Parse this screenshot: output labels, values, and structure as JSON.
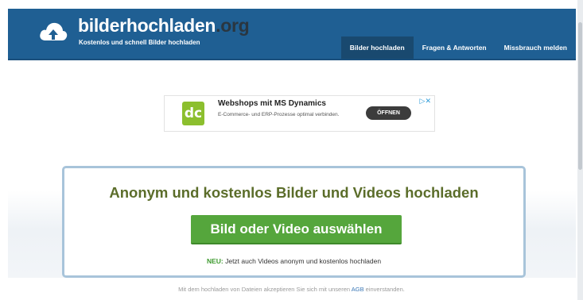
{
  "header": {
    "brand_main": "bilderhochladen",
    "brand_tld": ".org",
    "tagline": "Kostenlos und schnell Bilder hochladen",
    "logo_icon": "cloud-upload-icon",
    "nav": [
      {
        "label": "Bilder hochladen",
        "active": true
      },
      {
        "label": "Fragen & Antworten",
        "active": false
      },
      {
        "label": "Missbrauch melden",
        "active": false
      }
    ],
    "colors": {
      "bar": "#1f5f93",
      "active_tab": "#19496f"
    }
  },
  "ad": {
    "logo_text": "dc",
    "title": "Webshops mit MS Dynamics",
    "description": "E-Commerce- und ERP-Prozesse optimal verbinden.",
    "cta": "ÖFFNEN",
    "choices_icon": "adchoices-icon",
    "choices_text": "▷✕"
  },
  "main": {
    "headline": "Anonym und kostenlos Bilder und Videos hochladen",
    "upload_button": "Bild oder Video auswählen",
    "note_prefix": "NEU:",
    "note_text": " Jetzt auch Videos anonym und kostenlos hochladen",
    "colors": {
      "headline": "#5b6d2a",
      "button": "#55a63c",
      "border": "#a8c4da"
    }
  },
  "footer": {
    "before": "Mit dem hochladen von Dateien akzeptieren Sie sich mit unseren ",
    "link": "AGB",
    "after": " einverstanden."
  }
}
